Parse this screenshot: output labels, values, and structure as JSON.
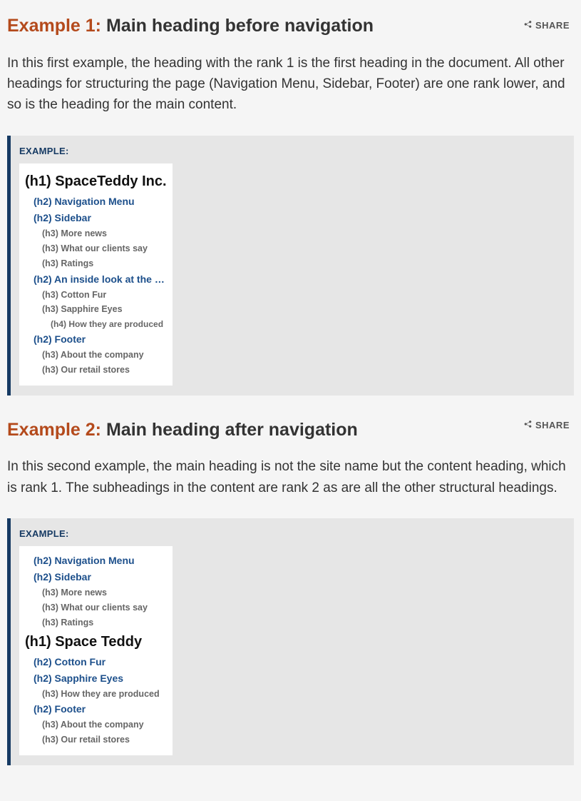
{
  "share_label": "SHARE",
  "example1": {
    "prefix": "Example 1:",
    "title": "Main heading before navigation",
    "para": "In this first example, the heading with the rank 1 is the first heading in the document. All other headings for structuring the page (Navigation Menu, Sidebar, Footer) are one rank lower, and so is the heading for the main content.",
    "box_label": "EXAMPLE:",
    "tree": {
      "h1": "(h1) SpaceTeddy Inc.",
      "nav": "(h2) Navigation Menu",
      "sidebar": "(h2) Sidebar",
      "more_news": "(h3) More news",
      "clients": "(h3) What our clients say",
      "ratings": "(h3) Ratings",
      "inside": "(h2) An inside look at the …",
      "cotton": "(h3) Cotton Fur",
      "sapphire": "(h3) Sapphire Eyes",
      "produced": "(h4) How they are produced",
      "footer": "(h2) Footer",
      "about": "(h3) About the company",
      "stores": "(h3) Our retail stores"
    }
  },
  "example2": {
    "prefix": "Example 2:",
    "title": "Main heading after navigation",
    "para": "In this second example, the main heading is not the site name but the content heading, which is rank 1. The subheadings in the content are rank 2 as are all the other structural headings.",
    "box_label": "EXAMPLE:",
    "tree": {
      "nav": "(h2) Navigation Menu",
      "sidebar": "(h2) Sidebar",
      "more_news": "(h3) More news",
      "clients": "(h3) What our clients say",
      "ratings": "(h3) Ratings",
      "h1": "(h1) Space Teddy",
      "cotton": "(h2) Cotton Fur",
      "sapphire": "(h2) Sapphire Eyes",
      "produced": "(h3) How they are produced",
      "footer": "(h2) Footer",
      "about": "(h3) About the company",
      "stores": "(h3) Our retail stores"
    }
  }
}
